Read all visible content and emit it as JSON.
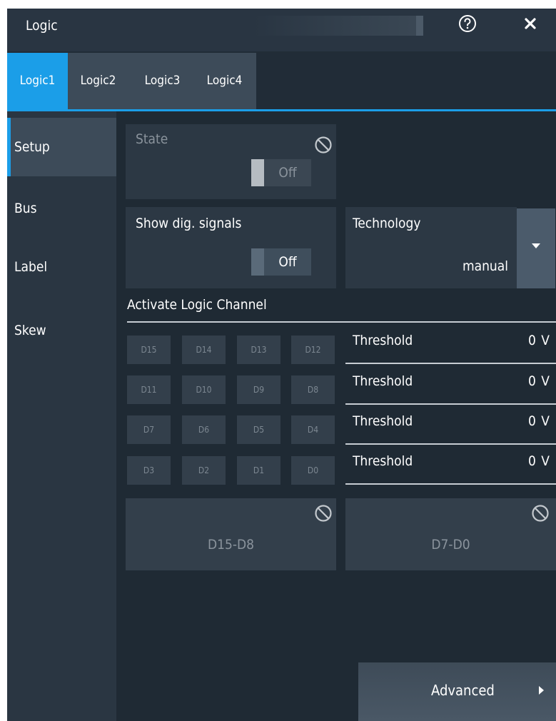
{
  "dialog": {
    "title": "Logic"
  },
  "tabs": [
    {
      "label": "Logic1",
      "active": true
    },
    {
      "label": "Logic2",
      "active": false
    },
    {
      "label": "Logic3",
      "active": false
    },
    {
      "label": "Logic4",
      "active": false
    }
  ],
  "sidenav": [
    {
      "label": "Setup",
      "active": true
    },
    {
      "label": "Bus",
      "active": false
    },
    {
      "label": "Label",
      "active": false
    },
    {
      "label": "Skew",
      "active": false
    }
  ],
  "state": {
    "label": "State",
    "value": "Off",
    "enabled": false
  },
  "show_signals": {
    "label": "Show dig. signals",
    "value": "Off"
  },
  "technology": {
    "label": "Technology",
    "value": "manual"
  },
  "activate": {
    "title": "Activate Logic Channel",
    "rows": [
      [
        "D15",
        "D14",
        "D13",
        "D12"
      ],
      [
        "D11",
        "D10",
        "D9",
        "D8"
      ],
      [
        "D7",
        "D6",
        "D5",
        "D4"
      ],
      [
        "D3",
        "D2",
        "D1",
        "D0"
      ]
    ],
    "thresholds": [
      {
        "label": "Threshold",
        "value": "0 V"
      },
      {
        "label": "Threshold",
        "value": "0 V"
      },
      {
        "label": "Threshold",
        "value": "0 V"
      },
      {
        "label": "Threshold",
        "value": "0 V"
      }
    ],
    "groups": [
      "D15-D8",
      "D7-D0"
    ]
  },
  "advanced": {
    "label": "Advanced"
  },
  "icons": {
    "help": "help-icon",
    "close": "close-icon",
    "block": "block-icon",
    "dropdown": "chevron-down-icon",
    "advanced": "chevron-right-icon"
  },
  "colors": {
    "accent": "#1b9ee8",
    "background": "#1f2a34",
    "panel": "#2c3844",
    "text_disabled": "#8a939c"
  }
}
